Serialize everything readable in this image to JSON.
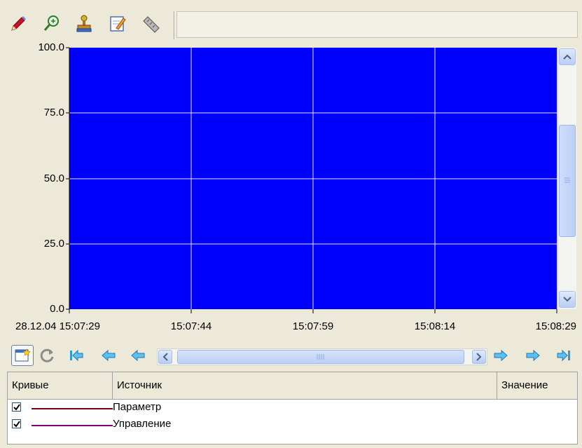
{
  "toolbar": {
    "buttons": [
      {
        "name": "pencil-icon"
      },
      {
        "name": "zoom-icon"
      },
      {
        "name": "stamp-icon"
      },
      {
        "name": "edit-note-icon"
      },
      {
        "name": "ruler-icon"
      }
    ]
  },
  "chart_data": {
    "type": "line",
    "title": "",
    "background": "#0000ff",
    "grid": true,
    "ylim": [
      0,
      100
    ],
    "y_ticks": [
      "100.0",
      "75.0",
      "50.0",
      "25.0",
      "0.0"
    ],
    "x_ticks": [
      "28.12.04 15:07:29",
      "15:07:44",
      "15:07:59",
      "15:08:14",
      "15:08:29"
    ],
    "series": [
      {
        "name": "Параметр",
        "color": "#800000",
        "values": []
      },
      {
        "name": "Управление",
        "color": "#800080",
        "values": []
      }
    ]
  },
  "navigation": {
    "buttons": [
      "new-icon",
      "refresh-icon",
      "first-icon",
      "prev-page-icon",
      "prev-icon"
    ],
    "right_buttons": [
      "next-icon",
      "next-page-icon",
      "last-icon"
    ],
    "scroll_position": 0.5
  },
  "legend": {
    "columns": [
      "Кривые",
      "Источник",
      "Значение"
    ],
    "rows": [
      {
        "checked": true,
        "color": "#800000",
        "source": "Параметр",
        "value": ""
      },
      {
        "checked": true,
        "color": "#800080",
        "source": "Управление",
        "value": ""
      }
    ]
  }
}
